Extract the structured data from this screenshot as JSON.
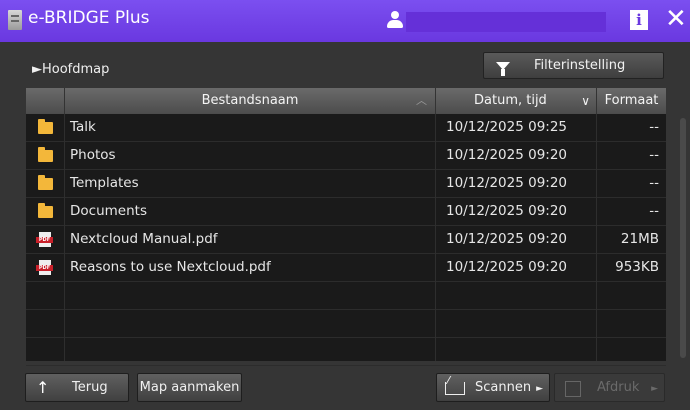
{
  "titlebar": {
    "title": "e-BRIDGE Plus",
    "app_icon": "document-icon",
    "user_icon": "user-icon",
    "info_label": "i",
    "close_label": "✕"
  },
  "breadcrumb": "►Hoofdmap",
  "filter_button": {
    "label": "Filterinstelling",
    "icon": "filter-icon"
  },
  "table": {
    "headers": {
      "name": "Bestandsnaam",
      "date": "Datum, tijd",
      "format": "Formaat"
    },
    "rows": [
      {
        "type": "folder",
        "name": "Talk",
        "date": "10/12/2025 09:25",
        "format": "--"
      },
      {
        "type": "folder",
        "name": "Photos",
        "date": "10/12/2025 09:20",
        "format": "--"
      },
      {
        "type": "folder",
        "name": "Templates",
        "date": "10/12/2025 09:20",
        "format": "--"
      },
      {
        "type": "folder",
        "name": "Documents",
        "date": "10/12/2025 09:20",
        "format": "--"
      },
      {
        "type": "pdf",
        "name": "Nextcloud Manual.pdf",
        "date": "10/12/2025 09:20",
        "format": "21MB"
      },
      {
        "type": "pdf",
        "name": "Reasons to use Nextcloud.pdf",
        "date": "10/12/2025 09:20",
        "format": "953KB"
      }
    ]
  },
  "bottom": {
    "back_label": "Terug",
    "new_folder_label": "Map aanmaken",
    "scan_label": "Scannen",
    "print_label": "Afdruk"
  },
  "colors": {
    "titlebar": "#6a38e0",
    "panel": "#353535",
    "table_bg": "#1a1a1a",
    "folder": "#f3b73a",
    "pdf": "#c8202a"
  }
}
